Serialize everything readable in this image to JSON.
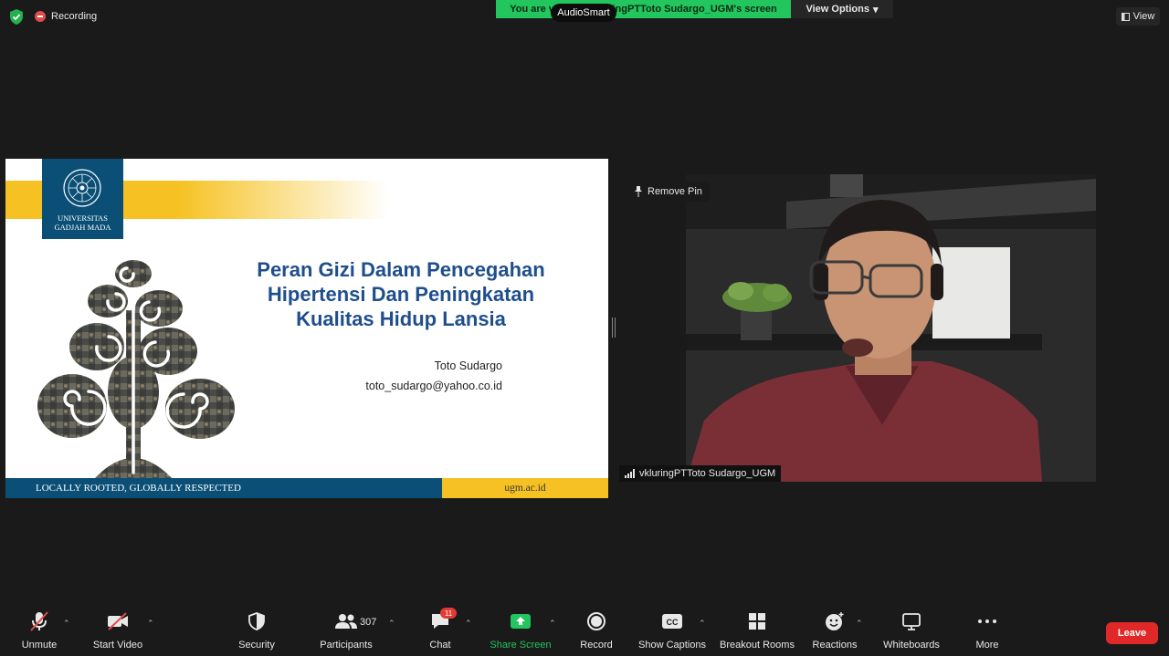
{
  "top_bar": {
    "recording_label": "Recording",
    "share_banner": "You are viewing vkluringPTToto Sudargo_UGM's screen",
    "audiosmart_label": "AudioSmart",
    "view_options_label": "View Options",
    "view_label": "View"
  },
  "slide": {
    "logo_line1": "UNIVERSITAS",
    "logo_line2": "GADJAH MADA",
    "title_line1": "Peran Gizi Dalam Pencegahan",
    "title_line2": "Hipertensi Dan Peningkatan",
    "title_line3": "Kualitas Hidup Lansia",
    "author": "Toto Sudargo",
    "email": "toto_sudargo@yahoo.co.id",
    "footer_motto": "LOCALLY ROOTED, GLOBALLY RESPECTED",
    "footer_url": "ugm.ac.id"
  },
  "video": {
    "remove_pin_label": "Remove Pin",
    "participant_name": "vkluringPTToto Sudargo_UGM"
  },
  "toolbar": {
    "unmute": "Unmute",
    "start_video": "Start Video",
    "security": "Security",
    "participants": "Participants",
    "participants_count": "307",
    "chat": "Chat",
    "chat_badge": "11",
    "share_screen": "Share Screen",
    "record": "Record",
    "show_captions": "Show Captions",
    "cc": "CC",
    "breakout_rooms": "Breakout Rooms",
    "reactions": "Reactions",
    "whiteboards": "Whiteboards",
    "more": "More",
    "leave": "Leave"
  },
  "colors": {
    "background": "#1a1a1a",
    "share_green": "#22c55e",
    "leave_red": "#e02828",
    "ugm_blue": "#0b4f76",
    "ugm_yellow": "#f6c223",
    "title_blue": "#1f4e8c"
  }
}
